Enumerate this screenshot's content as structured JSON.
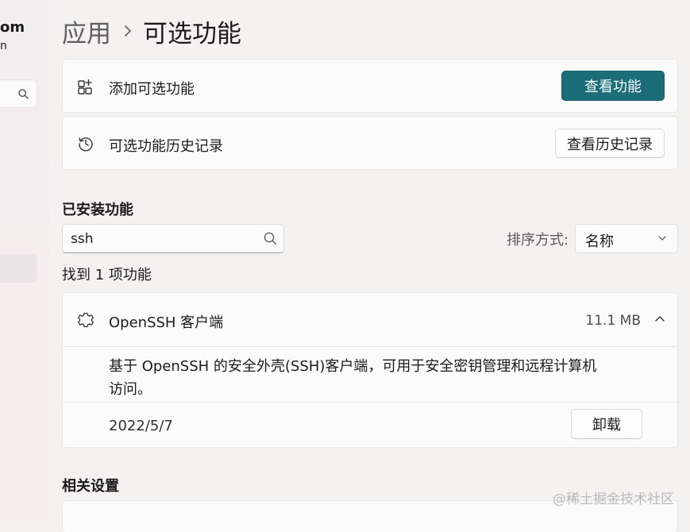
{
  "sidebar": {
    "account_name": "om",
    "account_email": "n",
    "search_icon": "search-icon"
  },
  "breadcrumb": {
    "parent": "应用",
    "current": "可选功能"
  },
  "add_feature": {
    "label": "添加可选功能",
    "button": "查看功能",
    "icon": "add-apps-icon"
  },
  "history": {
    "label": "可选功能历史记录",
    "button": "查看历史记录",
    "icon": "history-icon"
  },
  "installed": {
    "title": "已安装功能",
    "search_value": "ssh",
    "sort_label": "排序方式:",
    "sort_value": "名称",
    "found_text": "找到 1 项功能"
  },
  "feature": {
    "name": "OpenSSH 客户端",
    "size": "11.1 MB",
    "description": "基于 OpenSSH 的安全外壳(SSH)客户端，可用于安全密钥管理和远程计算机访问。",
    "date": "2022/5/7",
    "uninstall": "卸载",
    "icon": "puzzle-gear-icon"
  },
  "related": {
    "title": "相关设置"
  },
  "watermark": "@稀土掘金技术社区",
  "colors": {
    "accent": "#1b6d78",
    "background": "#f4f1f1",
    "card": "#fbfbfb"
  }
}
